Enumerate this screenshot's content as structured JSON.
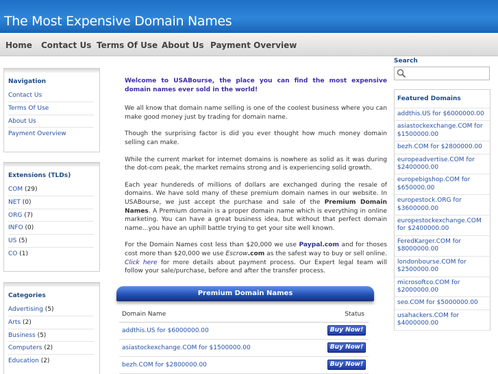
{
  "site": {
    "title": "The Most Expensive Domain Names"
  },
  "nav": [
    "Home",
    "Contact Us",
    "Terms Of Use",
    "About Us",
    "Payment Overview"
  ],
  "navigation": {
    "heading": "Navigation",
    "items": [
      "Contact Us",
      "Terms Of Use",
      "About Us",
      "Payment Overview"
    ]
  },
  "extensions": {
    "heading": "Extensions (TLDs)",
    "items": [
      {
        "name": "COM",
        "count": "(29)"
      },
      {
        "name": "NET",
        "count": "(0)"
      },
      {
        "name": "ORG",
        "count": "(7)"
      },
      {
        "name": "INFO",
        "count": "(0)"
      },
      {
        "name": "US",
        "count": "(5)"
      },
      {
        "name": "CO",
        "count": "(1)"
      }
    ]
  },
  "categories": {
    "heading": "Categories",
    "items": [
      {
        "name": "Advertising",
        "count": "(5)"
      },
      {
        "name": "Arts",
        "count": "(2)"
      },
      {
        "name": "Business",
        "count": "(5)"
      },
      {
        "name": "Computers",
        "count": "(2)"
      },
      {
        "name": "Education",
        "count": "(2)"
      }
    ]
  },
  "content": {
    "welcome": "Welcome to USABourse, the place you can find the most expensive domain names ever sold in the world!",
    "p1": "We all know that domain name selling is one of the coolest business where you can make good money just by trading for domain name.",
    "p2": "Though the surprising factor is did you ever thought how much money domain selling can make.",
    "p3": "While the current market for internet domains is nowhere as solid as it was during the dot-com peak, the market remains strong and is experiencing solid growth.",
    "p4_before": "Each year hundereds of millions of dollars are exchanged during the resale of domains. We have sold many of these premium domain names in our website. In USABourse, we just accept the purchase and sale of the ",
    "p4_bold": "Premium Domain Names",
    "p4_after": ". A Premium domain is a proper domain name which is everything in online marketing. You can have a great business idea, but without that perfect domain name...you have an uphill battle trying to get your site well known.",
    "p5_a": "For the Domain Names cost less than $20,000 we use ",
    "p5_paypal": "Paypal.com",
    "p5_b": " and for thoses cost more than $20,000 we use ",
    "p5_escrow_i": "Escrow",
    "p5_escrow_b": ".com",
    "p5_c": " as the safest way to buy or sell online. ",
    "p5_link": "Click here",
    "p5_d": " for more details about payment process. Our Expert legal team will follow your sale/purchase, before and after the transfer process."
  },
  "premium": {
    "title": "Premium Domain Names",
    "col_domain": "Domain Name",
    "col_status": "Status",
    "buy_label": "Buy Now!",
    "rows": [
      "addthis.US for $6000000.00",
      "asiastockexchange.COM for $1500000.00",
      "bezh.COM for $2800000.00"
    ]
  },
  "search": {
    "label": "Search",
    "placeholder": ""
  },
  "featured": {
    "heading": "Featured Domains",
    "items": [
      "addthis.US for $6000000.00",
      "asiastockexchange.COM for $1500000.00",
      "bezh.COM for $2800000.00",
      "europeadvertise.COM for $2400000.00",
      "europebigshop.COM for $650000.00",
      "europestock.ORG for $3600000.00",
      "europestockexchange.COM for $2400000.00",
      "FeredKarger.COM for $8000000.00",
      "londonbourse.COM for $2500000.00",
      "microsoftco.COM for $2000000.00",
      "seo.COM for $5000000.00",
      "usahackers.COM for $4000000.00"
    ]
  }
}
